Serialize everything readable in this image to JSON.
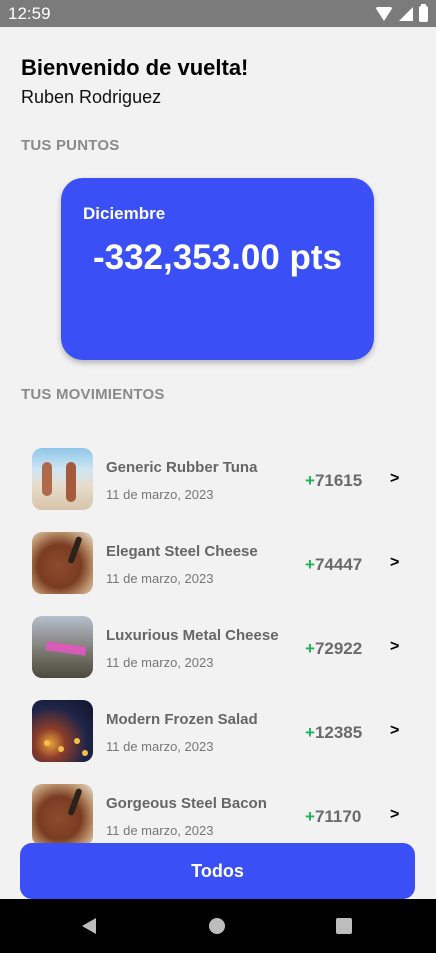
{
  "status_bar": {
    "time": "12:59"
  },
  "header": {
    "greeting": "Bienvenido de vuelta!",
    "user_name": "Ruben Rodriguez"
  },
  "points": {
    "section_label": "TUS PUNTOS",
    "month": "Diciembre",
    "value": "-332,353.00 pts"
  },
  "movements": {
    "section_label": "TUS MOVIMIENTOS",
    "items": [
      {
        "title": "Generic Rubber Tuna",
        "date": "11 de marzo, 2023",
        "sign": "+",
        "amount": "71615",
        "arrow": ">"
      },
      {
        "title": "Elegant Steel Cheese",
        "date": "11 de marzo, 2023",
        "sign": "+",
        "amount": "74447",
        "arrow": ">"
      },
      {
        "title": "Luxurious Metal Cheese",
        "date": "11 de marzo, 2023",
        "sign": "+",
        "amount": "72922",
        "arrow": ">"
      },
      {
        "title": "Modern Frozen Salad",
        "date": "11 de marzo, 2023",
        "sign": "+",
        "amount": "12385",
        "arrow": ">"
      },
      {
        "title": "Gorgeous Steel Bacon",
        "date": "11 de marzo, 2023",
        "sign": "+",
        "amount": "71170",
        "arrow": ">"
      }
    ]
  },
  "filter_button": {
    "label": "Todos"
  },
  "colors": {
    "accent": "#3a4ff5",
    "positive": "#1db45a",
    "section_label": "#8a8a8a"
  },
  "icons": [
    "wifi-icon",
    "signal-icon",
    "battery-icon",
    "chevron-right-icon",
    "back-icon",
    "home-icon",
    "recents-icon"
  ]
}
